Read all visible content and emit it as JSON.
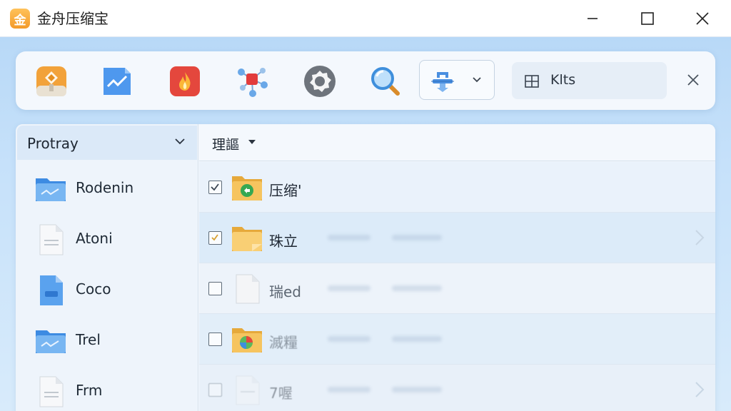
{
  "window": {
    "logo_glyph": "金",
    "title": "金舟压缩宝",
    "controls": [
      "minimize-icon",
      "maximize-icon",
      "close-icon"
    ]
  },
  "toolbar": {
    "tools": [
      "package-icon",
      "chart-icon",
      "flame-icon",
      "network-icon",
      "gear-icon",
      "search-magnifier-icon"
    ],
    "dropdown_icon": "extract-icon",
    "search": {
      "icon": "grid-icon",
      "value": "Klts"
    },
    "close_icon": "close-icon"
  },
  "sidebar": {
    "header": "Protray",
    "items": [
      {
        "label": "Rodenin",
        "icon": "folder-icon"
      },
      {
        "label": "Atoni",
        "icon": "document-icon"
      },
      {
        "label": "Coco",
        "icon": "blue-document-icon"
      },
      {
        "label": "Trel",
        "icon": "folder-icon"
      },
      {
        "label": "Frm",
        "icon": "document-icon"
      }
    ]
  },
  "content": {
    "header": "理謳",
    "rows": [
      {
        "name": "压缩'",
        "checked": true,
        "icon": "green-folder-icon"
      },
      {
        "name": "珠立",
        "checked": true,
        "icon": "folder-icon"
      },
      {
        "name": "瑞ed",
        "checked": false,
        "icon": "document-icon"
      },
      {
        "name": "滅糧",
        "checked": false,
        "icon": "colorful-folder-icon"
      },
      {
        "name": "7喔",
        "checked": false,
        "icon": "document-icon"
      }
    ]
  },
  "colors": {
    "accent": "#3b8ae6",
    "folder": "#f5c45c",
    "logo": "#f39a2a"
  }
}
